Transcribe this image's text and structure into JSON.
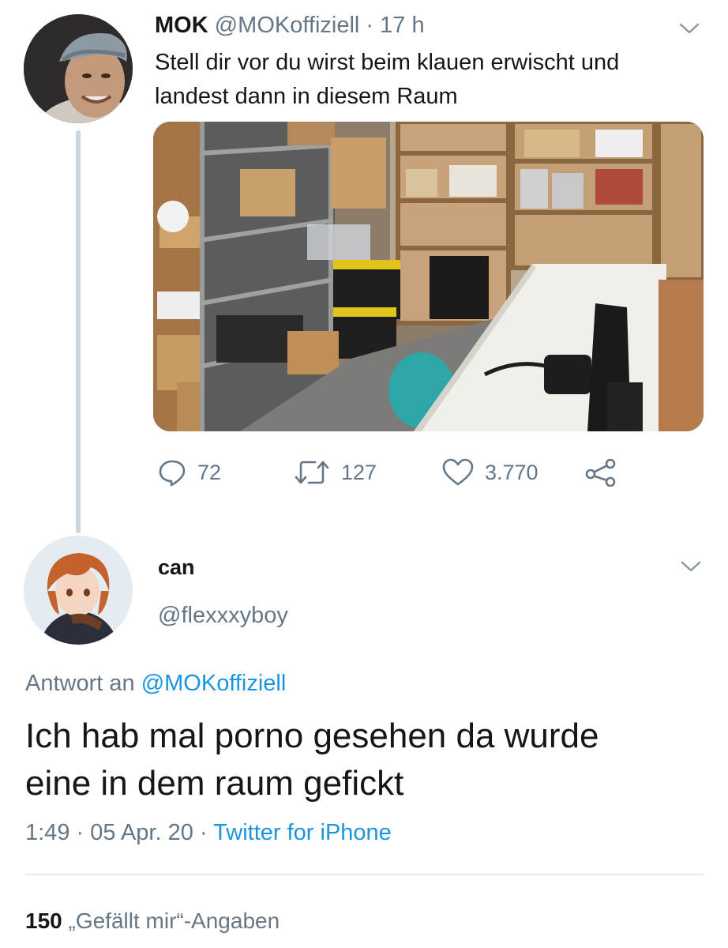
{
  "parent_tweet": {
    "display_name": "MOK",
    "handle": "@MOKoffiziell",
    "separator": "·",
    "time": "17 h",
    "text_line1": "Stell dir vor du wirst beim klauen erwischt und",
    "text_line2": "landest dann in diesem Raum",
    "actions": {
      "replies": "72",
      "retweets": "127",
      "likes": "3.770"
    }
  },
  "reply_tweet": {
    "display_name": "can",
    "handle": "@flexxxyboy",
    "reply_prefix": "Antwort an",
    "reply_to": "@MOKoffiziell",
    "text_line1": "Ich hab mal porno gesehen da wurde",
    "text_line2": "eine in dem raum gefickt",
    "time": "1:49",
    "sep": "·",
    "date": "05 Apr. 20",
    "source": "Twitter for iPhone",
    "likes_count": "150",
    "likes_label": "„Gefällt mir“-Angaben"
  },
  "icons": [
    "chevron-down-icon",
    "reply-icon",
    "retweet-icon",
    "like-icon",
    "share-icon"
  ],
  "colors": {
    "link": "#1b95e0",
    "muted": "#657786",
    "thread_line": "#ccd6dd",
    "text": "#14171a"
  }
}
